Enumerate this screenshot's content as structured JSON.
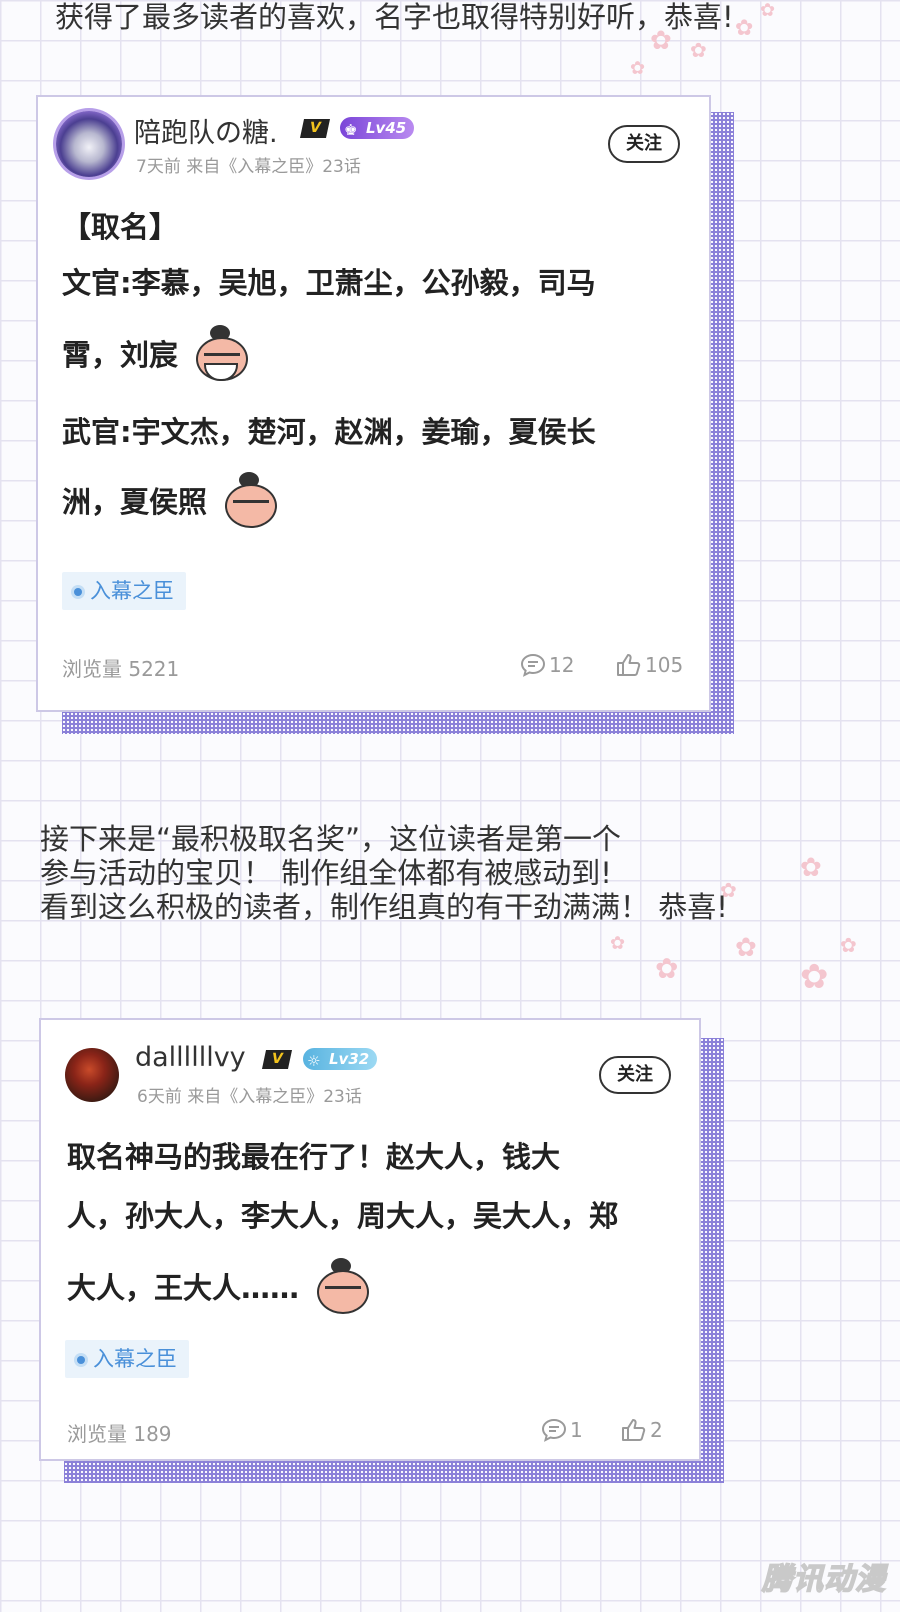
{
  "captions": {
    "top": "获得了最多读者的喜欢，名字也取得特别好听，恭喜!",
    "middle": "接下来是“最积极取名奖”，这位读者是第一个\n参与活动的宝贝！ 制作组全体都有被感动到!\n看到这么积极的读者，制作组真的有干劲满满！ 恭喜!"
  },
  "posts": [
    {
      "username": "陪跑队の糖.",
      "vip_badge": "V",
      "level": "Lv45",
      "meta": "7天前 来自《入幕之臣》23话",
      "follow_label": "关注",
      "lines": [
        "【取名】",
        "文官:李慕，吴旭，卫萧尘，公孙毅，司马",
        "霄，刘宸",
        "武官:宇文杰，楚河，赵渊，姜瑜，夏侯长",
        "洲，夏侯照"
      ],
      "tag": "入幕之臣",
      "views": "浏览量 5221",
      "comments": "12",
      "likes": "105"
    },
    {
      "username": "dallllllvy",
      "vip_badge": "V",
      "level": "Lv32",
      "meta": "6天前 来自《入幕之臣》23话",
      "follow_label": "关注",
      "lines": [
        "取名神马的我最在行了！赵大人，钱大",
        "人，孙大人，李大人，周大人，吴大人，郑",
        "大人，王大人……"
      ],
      "tag": "入幕之臣",
      "views": "浏览量 189",
      "comments": "1",
      "likes": "2"
    }
  ],
  "watermark": "腾讯动漫",
  "icons": {
    "avatar": "avatar-image",
    "vip": "vip-badge-icon",
    "level": "level-badge-icon",
    "comment": "comment-icon",
    "like": "thumbs-up-icon",
    "tag_dot": "topic-dot-icon",
    "emoji": "sticker-icon",
    "flower": "flower-decoration-icon"
  },
  "colors": {
    "shadow": "#8a7fd8",
    "tag_text": "#4a90d9",
    "tag_bg": "#eaf3fb",
    "grid": "#e4e2f0",
    "lv45": "#7a45d8",
    "lv32": "#58b3e0"
  }
}
